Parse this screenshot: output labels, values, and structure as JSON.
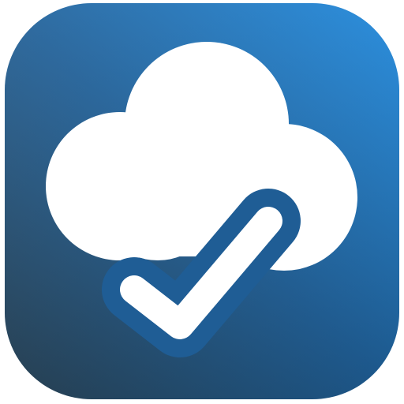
{
  "icon": {
    "name": "cloud-check-app-icon",
    "glyph": "cloud-check-icon"
  },
  "colors": {
    "gradient_top_right": "#1a86dc",
    "gradient_mid": "#1e5f98",
    "gradient_bottom_left": "#2b4558",
    "glyph": "#ffffff"
  }
}
